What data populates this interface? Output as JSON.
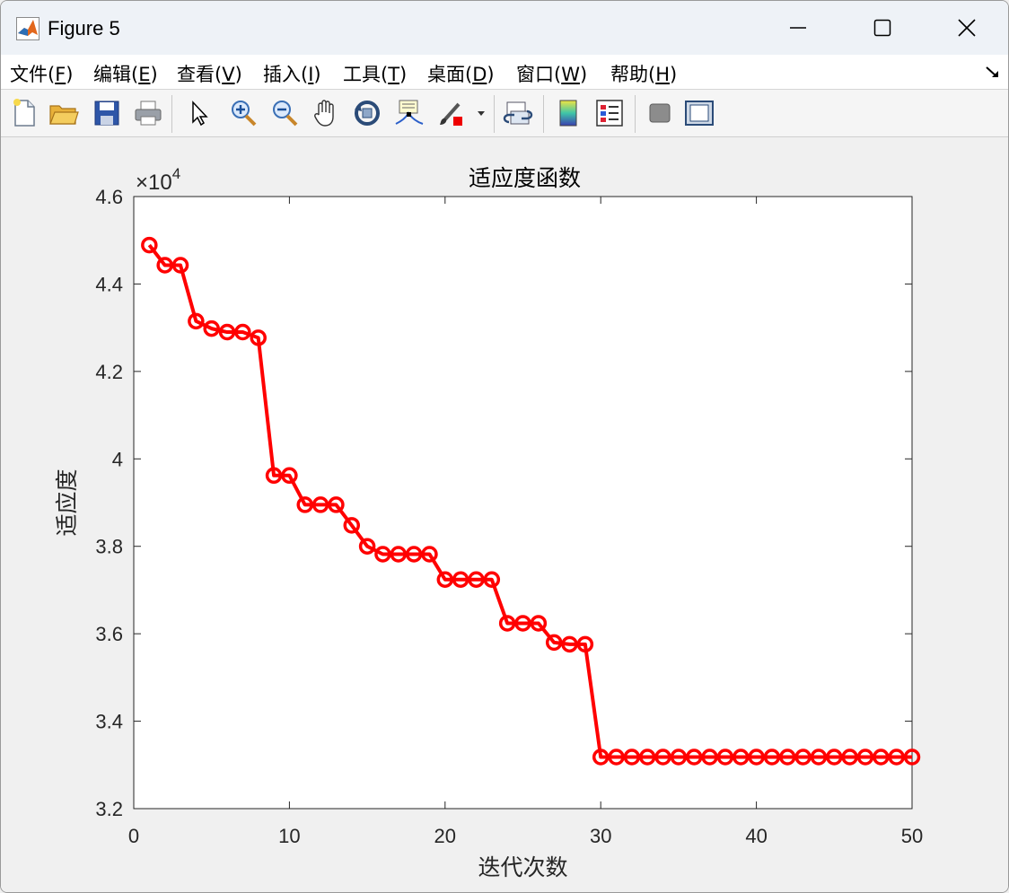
{
  "window": {
    "title": "Figure 5",
    "minimize_glyph": "—",
    "maximize_glyph": "☐",
    "close_glyph": "✕"
  },
  "menu": [
    {
      "label": "文件(",
      "mnemonic": "F",
      "suffix": ")"
    },
    {
      "label": "编辑(",
      "mnemonic": "E",
      "suffix": ")"
    },
    {
      "label": "查看(",
      "mnemonic": "V",
      "suffix": ")"
    },
    {
      "label": "插入(",
      "mnemonic": "I",
      "suffix": ")"
    },
    {
      "label": "工具(",
      "mnemonic": "T",
      "suffix": ")"
    },
    {
      "label": "桌面(",
      "mnemonic": "D",
      "suffix": ")"
    },
    {
      "label": "窗口(",
      "mnemonic": "W",
      "suffix": ")"
    },
    {
      "label": "帮助(",
      "mnemonic": "H",
      "suffix": ")"
    }
  ],
  "toolbar": [
    "new-figure-icon",
    "open-file-icon",
    "save-icon",
    "print-icon",
    "pointer-icon",
    "zoom-in-icon",
    "zoom-out-icon",
    "pan-icon",
    "rotate-3d-icon",
    "data-cursor-icon",
    "brush-icon",
    "link-plot-icon",
    "colorbar-icon",
    "legend-icon",
    "hide-plot-tools-icon",
    "show-plot-tools-icon"
  ],
  "chart_data": {
    "type": "line",
    "title": "适应度函数",
    "xlabel": "迭代次数",
    "ylabel": "适应度",
    "exponent_label": "×10",
    "exponent_power": "4",
    "xlim": [
      0,
      50
    ],
    "ylim": [
      3.2,
      4.6
    ],
    "x_ticks": [
      "0",
      "10",
      "20",
      "30",
      "40",
      "50"
    ],
    "y_ticks": [
      "3.2",
      "3.4",
      "3.6",
      "3.8",
      "4",
      "4.2",
      "4.4",
      "4.6"
    ],
    "line_color": "#ff0000",
    "marker": "circle",
    "grid": false,
    "x": [
      1,
      2,
      3,
      4,
      5,
      6,
      7,
      8,
      9,
      10,
      11,
      12,
      13,
      14,
      15,
      16,
      17,
      18,
      19,
      20,
      21,
      22,
      23,
      24,
      25,
      26,
      27,
      28,
      29,
      30,
      31,
      32,
      33,
      34,
      35,
      36,
      37,
      38,
      39,
      40,
      41,
      42,
      43,
      44,
      45,
      46,
      47,
      48,
      49,
      50
    ],
    "y": [
      4.489,
      4.443,
      4.443,
      4.315,
      4.298,
      4.29,
      4.29,
      4.277,
      3.962,
      3.962,
      3.895,
      3.895,
      3.895,
      3.848,
      3.8,
      3.782,
      3.782,
      3.782,
      3.782,
      3.724,
      3.724,
      3.724,
      3.724,
      3.624,
      3.624,
      3.624,
      3.58,
      3.576,
      3.576,
      3.318,
      3.318,
      3.318,
      3.318,
      3.318,
      3.318,
      3.318,
      3.318,
      3.318,
      3.318,
      3.318,
      3.318,
      3.318,
      3.318,
      3.318,
      3.318,
      3.318,
      3.318,
      3.318,
      3.318,
      3.318
    ]
  }
}
